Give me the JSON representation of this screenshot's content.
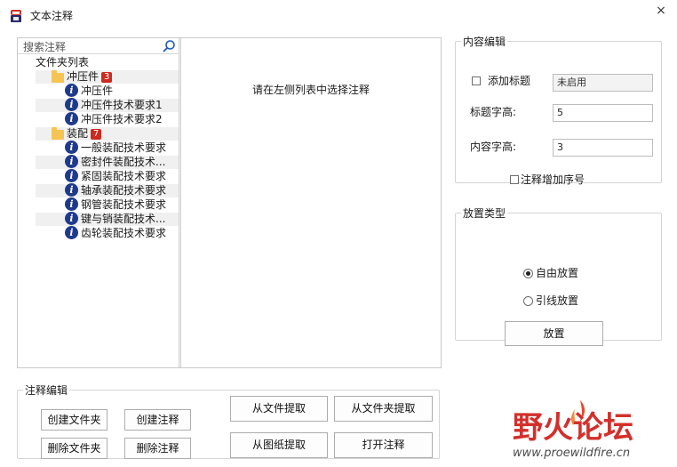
{
  "window": {
    "title": "文本注释",
    "close_glyph": "×"
  },
  "search": {
    "placeholder": "搜索注释"
  },
  "tree": {
    "root": "文件夹列表",
    "folders": [
      {
        "name": "冲压件",
        "count": "3",
        "items": [
          "冲压件",
          "冲压件技术要求1",
          "冲压件技术要求2"
        ]
      },
      {
        "name": "装配",
        "count": "7",
        "items": [
          "一般装配技术要求",
          "密封件装配技术...",
          "紧固装配技术要求",
          "轴承装配技术要求",
          "钢管装配技术要求",
          "键与销装配技术...",
          "齿轮装配技术要求"
        ]
      }
    ]
  },
  "preview": {
    "hint": "请在左侧列表中选择注释"
  },
  "content_edit": {
    "legend": "内容编辑",
    "add_title_label": "添加标题",
    "add_title_value": "未启用",
    "title_height_label": "标题字高:",
    "title_height_value": "5",
    "content_height_label": "内容字高:",
    "content_height_value": "3",
    "numbering_label": "注释增加序号"
  },
  "placement": {
    "legend": "放置类型",
    "free_label": "自由放置",
    "leader_label": "引线放置",
    "selected": "free",
    "place_button": "放置"
  },
  "annotation_edit": {
    "legend": "注释编辑",
    "create_folder": "创建文件夹",
    "create_note": "创建注释",
    "delete_folder": "删除文件夹",
    "delete_note": "删除注释"
  },
  "actions": {
    "extract_file": "从文件提取",
    "extract_folder": "从文件夹提取",
    "extract_drawing": "从图纸提取",
    "open_note": "打开注释"
  },
  "watermark": {
    "cn": "野火论坛",
    "url": "www.proewildfire.cn"
  },
  "colors": {
    "badge": "#cc2b1f",
    "folder": "#f6c453",
    "info_icon": "#1f3a8c",
    "logo_red": "#d2302c"
  }
}
